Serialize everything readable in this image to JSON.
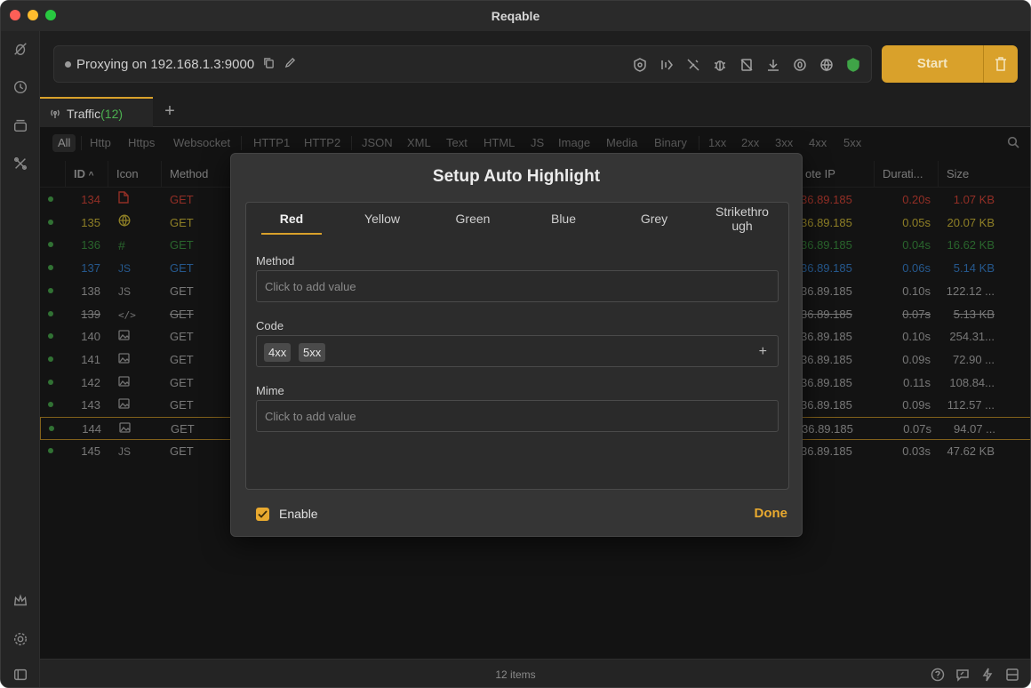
{
  "window": {
    "title": "Reqable"
  },
  "proxy": {
    "status_text": "Proxying on 192.168.1.3:9000",
    "start_label": "Start"
  },
  "tabs": [
    {
      "label": "Traffic",
      "count": "(12)"
    }
  ],
  "filters": [
    "All",
    "Http",
    "Https",
    "Websocket",
    "HTTP1",
    "HTTP2",
    "JSON",
    "XML",
    "Text",
    "HTML",
    "JS",
    "Image",
    "Media",
    "Binary",
    "1xx",
    "2xx",
    "3xx",
    "4xx",
    "5xx"
  ],
  "table": {
    "headers": {
      "id": "ID",
      "icon": "Icon",
      "method": "Method",
      "ip": "ote IP",
      "duration": "Durati...",
      "size": "Size"
    },
    "rows": [
      {
        "id": "134",
        "icon": "file",
        "method": "GET",
        "ip": "36.89.185",
        "dur": "0.20s",
        "size": "1.07 KB",
        "color": "#e0483a",
        "strike": false
      },
      {
        "id": "135",
        "icon": "globe",
        "method": "GET",
        "ip": "36.89.185",
        "dur": "0.05s",
        "size": "20.07 KB",
        "color": "#d9c23a",
        "strike": false
      },
      {
        "id": "136",
        "icon": "hash",
        "method": "GET",
        "ip": "36.89.185",
        "dur": "0.04s",
        "size": "16.62 KB",
        "color": "#3f9a44",
        "strike": false
      },
      {
        "id": "137",
        "icon": "JS",
        "method": "GET",
        "ip": "36.89.185",
        "dur": "0.06s",
        "size": "5.14 KB",
        "color": "#3a87d9",
        "strike": false
      },
      {
        "id": "138",
        "icon": "JS",
        "method": "GET",
        "ip": "36.89.185",
        "dur": "0.10s",
        "size": "122.12 ...",
        "color": "#9a9a9a",
        "strike": false
      },
      {
        "id": "139",
        "icon": "code",
        "method": "GET",
        "ip": "36.89.185",
        "dur": "0.07s",
        "size": "5.13 KB",
        "color": "#c8c8c8",
        "strike": true
      },
      {
        "id": "140",
        "icon": "image",
        "method": "GET",
        "ip": "36.89.185",
        "dur": "0.10s",
        "size": "254.31...",
        "color": "#c8c8c8",
        "strike": false
      },
      {
        "id": "141",
        "icon": "image",
        "method": "GET",
        "ip": "36.89.185",
        "dur": "0.09s",
        "size": "72.90 ...",
        "color": "#c8c8c8",
        "strike": false
      },
      {
        "id": "142",
        "icon": "image",
        "method": "GET",
        "ip": "36.89.185",
        "dur": "0.11s",
        "size": "108.84...",
        "color": "#c8c8c8",
        "strike": false
      },
      {
        "id": "143",
        "icon": "image",
        "method": "GET",
        "ip": "36.89.185",
        "dur": "0.09s",
        "size": "112.57 ...",
        "color": "#c8c8c8",
        "strike": false
      },
      {
        "id": "144",
        "icon": "image",
        "method": "GET",
        "ip": "36.89.185",
        "dur": "0.07s",
        "size": "94.07 ...",
        "color": "#c8c8c8",
        "strike": false
      },
      {
        "id": "145",
        "icon": "JS",
        "method": "GET",
        "ip": "36.89.185",
        "dur": "0.03s",
        "size": "47.62 KB",
        "color": "#c8c8c8",
        "strike": false
      }
    ]
  },
  "status_bar": {
    "text": "12 items"
  },
  "dialog": {
    "title": "Setup Auto Highlight",
    "tabs": [
      "Red",
      "Yellow",
      "Green",
      "Blue",
      "Grey",
      "Strikethro ugh"
    ],
    "method_label": "Method",
    "method_placeholder": "Click to add value",
    "code_label": "Code",
    "code_tags": [
      "4xx",
      "5xx"
    ],
    "mime_label": "Mime",
    "mime_placeholder": "Click to add value",
    "enable_label": "Enable",
    "enable_checked": true,
    "done_label": "Done"
  },
  "colors": {
    "accent": "#d9a12b",
    "success": "#4caf50"
  }
}
